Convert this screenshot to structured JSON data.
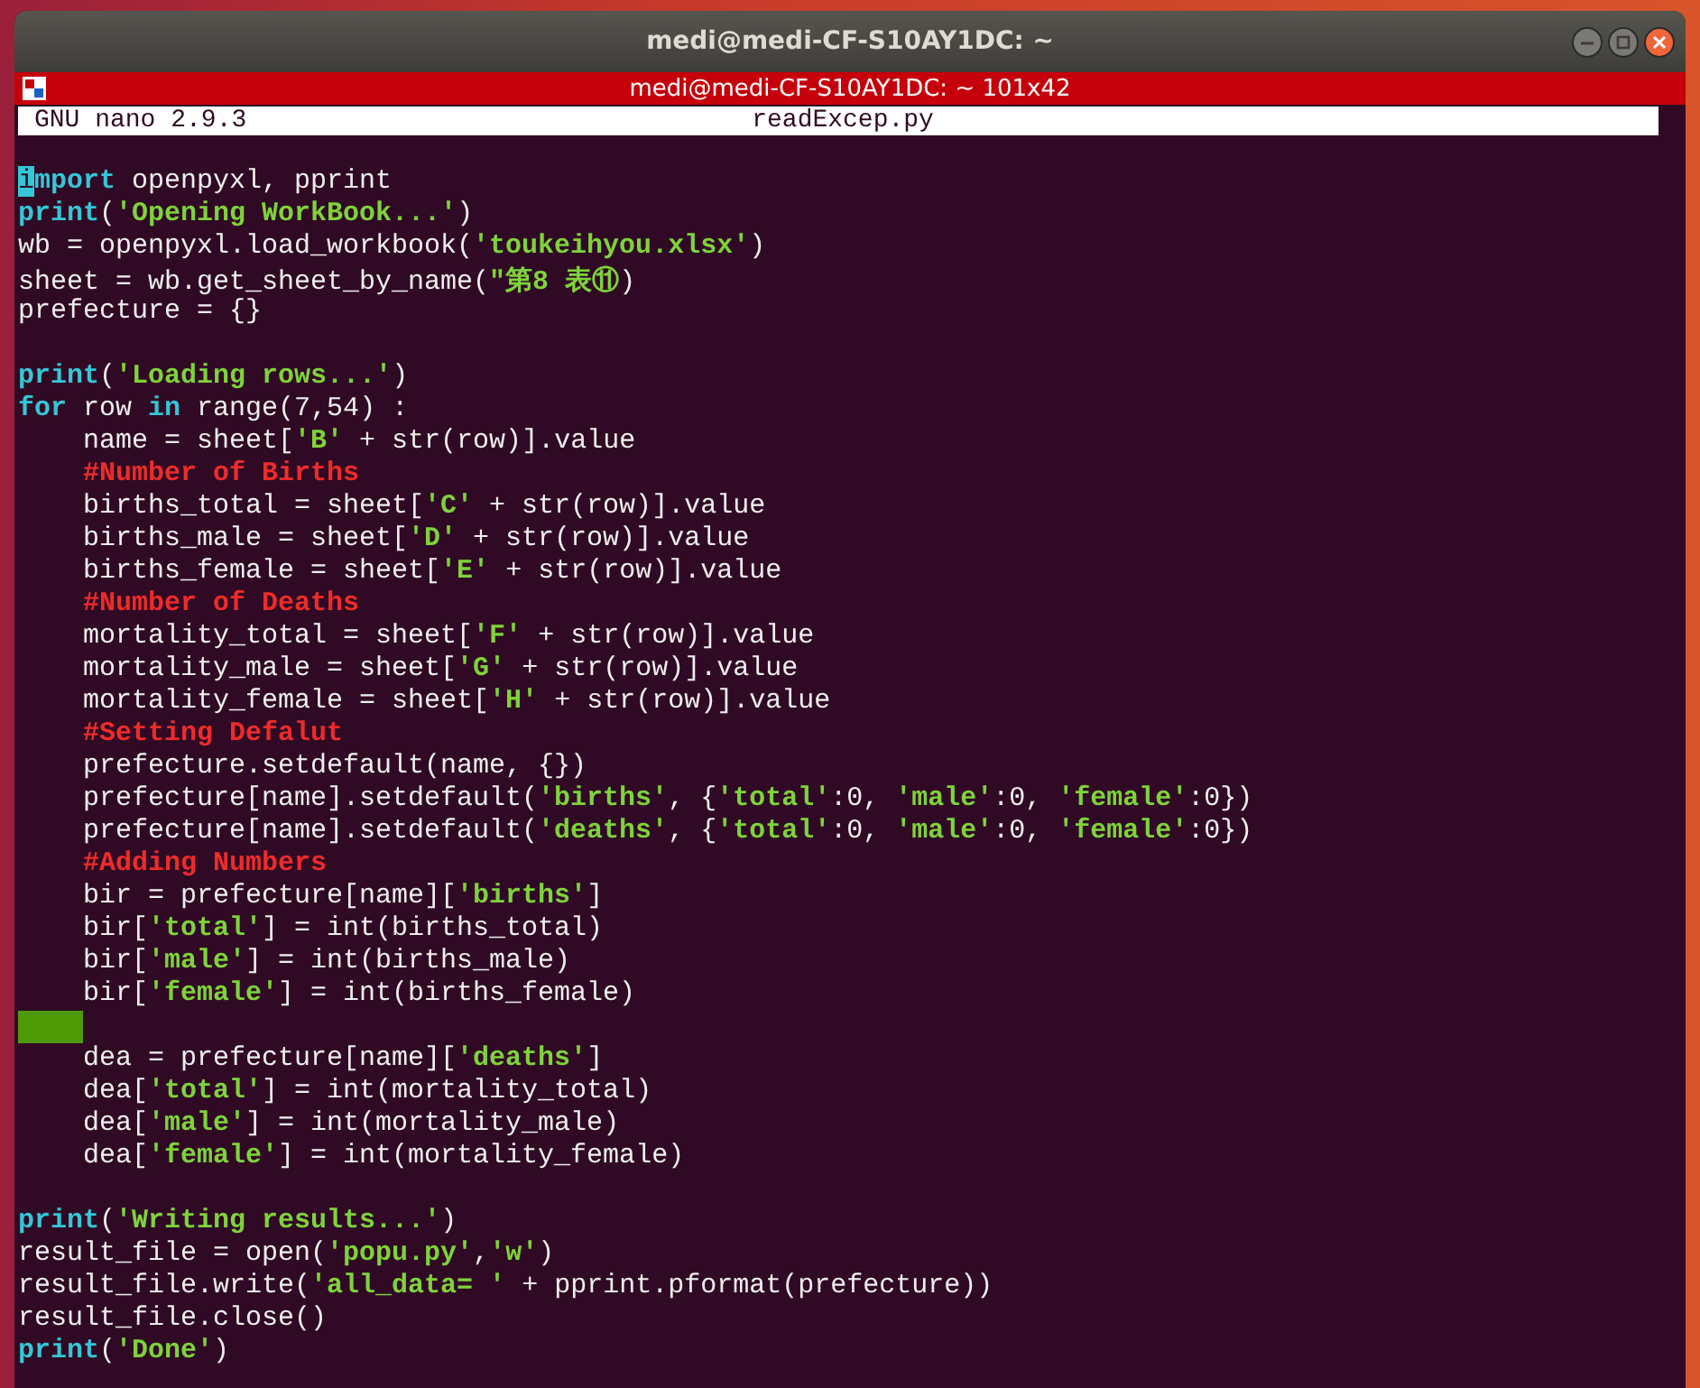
{
  "window": {
    "title": "medi@medi-CF-S10AY1DC: ~"
  },
  "terminal_bar": {
    "title": "medi@medi-CF-S10AY1DC: ~ 101x42"
  },
  "nano_header": {
    "version": "GNU nano 2.9.3",
    "filename": "readExcep.py"
  },
  "lines": [
    {
      "kind": "code",
      "segments": [
        {
          "kind": "cursor",
          "text": "i"
        },
        {
          "kind": "keyword",
          "text": "mport"
        },
        {
          "kind": "plain",
          "text": " openpyxl, pprint"
        }
      ]
    },
    {
      "kind": "code",
      "segments": [
        {
          "kind": "keyword",
          "text": "print"
        },
        {
          "kind": "plain",
          "text": "("
        },
        {
          "kind": "string",
          "text": "'Opening WorkBook...'"
        },
        {
          "kind": "plain",
          "text": ")"
        }
      ]
    },
    {
      "kind": "code",
      "segments": [
        {
          "kind": "plain",
          "text": "wb = openpyxl.load_workbook("
        },
        {
          "kind": "string",
          "text": "'toukeihyou.xlsx'"
        },
        {
          "kind": "plain",
          "text": ")"
        }
      ]
    },
    {
      "kind": "code",
      "segments": [
        {
          "kind": "plain",
          "text": "sheet = wb.get_sheet_by_name("
        },
        {
          "kind": "string",
          "text": "\"第8 表⑪"
        },
        {
          "kind": "plain",
          "text": ")"
        }
      ]
    },
    {
      "kind": "code",
      "segments": [
        {
          "kind": "plain",
          "text": "prefecture = {}"
        }
      ]
    },
    {
      "kind": "blank"
    },
    {
      "kind": "code",
      "segments": [
        {
          "kind": "keyword",
          "text": "print"
        },
        {
          "kind": "plain",
          "text": "("
        },
        {
          "kind": "string",
          "text": "'Loading rows...'"
        },
        {
          "kind": "plain",
          "text": ")"
        }
      ]
    },
    {
      "kind": "code",
      "segments": [
        {
          "kind": "keyword",
          "text": "for"
        },
        {
          "kind": "plain",
          "text": " row "
        },
        {
          "kind": "keyword",
          "text": "in"
        },
        {
          "kind": "plain",
          "text": " range(7,54) :"
        }
      ],
      "children": [
        {
          "kind": "code",
          "segments": [
            {
              "kind": "plain",
              "text": "name = sheet["
            },
            {
              "kind": "string",
              "text": "'B'"
            },
            {
              "kind": "plain",
              "text": " + str(row)].value"
            }
          ]
        },
        {
          "kind": "code",
          "segments": [
            {
              "kind": "comment",
              "text": "#Number of Births"
            }
          ]
        },
        {
          "kind": "code",
          "segments": [
            {
              "kind": "plain",
              "text": "births_total = sheet["
            },
            {
              "kind": "string",
              "text": "'C'"
            },
            {
              "kind": "plain",
              "text": " + str(row)].value"
            }
          ]
        },
        {
          "kind": "code",
          "segments": [
            {
              "kind": "plain",
              "text": "births_male = sheet["
            },
            {
              "kind": "string",
              "text": "'D'"
            },
            {
              "kind": "plain",
              "text": " + str(row)].value"
            }
          ]
        },
        {
          "kind": "code",
          "segments": [
            {
              "kind": "plain",
              "text": "births_female = sheet["
            },
            {
              "kind": "string",
              "text": "'E'"
            },
            {
              "kind": "plain",
              "text": " + str(row)].value"
            }
          ]
        },
        {
          "kind": "code",
          "segments": [
            {
              "kind": "comment",
              "text": "#Number of Deaths"
            }
          ]
        },
        {
          "kind": "code",
          "segments": [
            {
              "kind": "plain",
              "text": "mortality_total = sheet["
            },
            {
              "kind": "string",
              "text": "'F'"
            },
            {
              "kind": "plain",
              "text": " + str(row)].value"
            }
          ]
        },
        {
          "kind": "code",
          "segments": [
            {
              "kind": "plain",
              "text": "mortality_male = sheet["
            },
            {
              "kind": "string",
              "text": "'G'"
            },
            {
              "kind": "plain",
              "text": " + str(row)].value"
            }
          ]
        },
        {
          "kind": "code",
          "segments": [
            {
              "kind": "plain",
              "text": "mortality_female = sheet["
            },
            {
              "kind": "string",
              "text": "'H'"
            },
            {
              "kind": "plain",
              "text": " + str(row)].value"
            }
          ]
        },
        {
          "kind": "code",
          "segments": [
            {
              "kind": "comment",
              "text": "#Setting Defalut"
            }
          ]
        },
        {
          "kind": "code",
          "segments": [
            {
              "kind": "plain",
              "text": "prefecture.setdefault(name, {})"
            }
          ]
        },
        {
          "kind": "code",
          "segments": [
            {
              "kind": "plain",
              "text": "prefecture[name].setdefault("
            },
            {
              "kind": "string",
              "text": "'births'"
            },
            {
              "kind": "plain",
              "text": ", {"
            },
            {
              "kind": "string",
              "text": "'total'"
            },
            {
              "kind": "plain",
              "text": ":0, "
            },
            {
              "kind": "string",
              "text": "'male'"
            },
            {
              "kind": "plain",
              "text": ":0, "
            },
            {
              "kind": "string",
              "text": "'female'"
            },
            {
              "kind": "plain",
              "text": ":0})"
            }
          ]
        },
        {
          "kind": "code",
          "segments": [
            {
              "kind": "plain",
              "text": "prefecture[name].setdefault("
            },
            {
              "kind": "string",
              "text": "'deaths'"
            },
            {
              "kind": "plain",
              "text": ", {"
            },
            {
              "kind": "string",
              "text": "'total'"
            },
            {
              "kind": "plain",
              "text": ":0, "
            },
            {
              "kind": "string",
              "text": "'male'"
            },
            {
              "kind": "plain",
              "text": ":0, "
            },
            {
              "kind": "string",
              "text": "'female'"
            },
            {
              "kind": "plain",
              "text": ":0})"
            }
          ]
        },
        {
          "kind": "code",
          "segments": [
            {
              "kind": "comment",
              "text": "#Adding Numbers"
            }
          ]
        },
        {
          "kind": "code",
          "segments": [
            {
              "kind": "plain",
              "text": "bir = prefecture[name]["
            },
            {
              "kind": "string",
              "text": "'births'"
            },
            {
              "kind": "plain",
              "text": "]"
            }
          ]
        },
        {
          "kind": "code",
          "segments": [
            {
              "kind": "plain",
              "text": "bir["
            },
            {
              "kind": "string",
              "text": "'total'"
            },
            {
              "kind": "plain",
              "text": "] = int(births_total)"
            }
          ]
        },
        {
          "kind": "code",
          "segments": [
            {
              "kind": "plain",
              "text": "bir["
            },
            {
              "kind": "string",
              "text": "'male'"
            },
            {
              "kind": "plain",
              "text": "] = int(births_male)"
            }
          ]
        },
        {
          "kind": "code",
          "segments": [
            {
              "kind": "plain",
              "text": "bir["
            },
            {
              "kind": "string",
              "text": "'female'"
            },
            {
              "kind": "plain",
              "text": "] = int(births_female)"
            }
          ]
        },
        {
          "kind": "whitespace"
        },
        {
          "kind": "code",
          "segments": [
            {
              "kind": "plain",
              "text": "dea = prefecture[name]["
            },
            {
              "kind": "string",
              "text": "'deaths'"
            },
            {
              "kind": "plain",
              "text": "]"
            }
          ]
        },
        {
          "kind": "code",
          "segments": [
            {
              "kind": "plain",
              "text": "dea["
            },
            {
              "kind": "string",
              "text": "'total'"
            },
            {
              "kind": "plain",
              "text": "] = int(mortality_total)"
            }
          ]
        },
        {
          "kind": "code",
          "segments": [
            {
              "kind": "plain",
              "text": "dea["
            },
            {
              "kind": "string",
              "text": "'male'"
            },
            {
              "kind": "plain",
              "text": "] = int(mortality_male)"
            }
          ]
        },
        {
          "kind": "code",
          "segments": [
            {
              "kind": "plain",
              "text": "dea["
            },
            {
              "kind": "string",
              "text": "'female'"
            },
            {
              "kind": "plain",
              "text": "] = int(mortality_female)"
            }
          ]
        }
      ]
    },
    {
      "kind": "blank"
    },
    {
      "kind": "code",
      "segments": [
        {
          "kind": "keyword",
          "text": "print"
        },
        {
          "kind": "plain",
          "text": "("
        },
        {
          "kind": "string",
          "text": "'Writing results...'"
        },
        {
          "kind": "plain",
          "text": ")"
        }
      ]
    },
    {
      "kind": "code",
      "segments": [
        {
          "kind": "plain",
          "text": "result_file = open("
        },
        {
          "kind": "string",
          "text": "'popu.py'"
        },
        {
          "kind": "plain",
          "text": ","
        },
        {
          "kind": "string",
          "text": "'w'"
        },
        {
          "kind": "plain",
          "text": ")"
        }
      ]
    },
    {
      "kind": "code",
      "segments": [
        {
          "kind": "plain",
          "text": "result_file.write("
        },
        {
          "kind": "string",
          "text": "'all_data= '"
        },
        {
          "kind": "plain",
          "text": " + pprint.pformat(prefecture))"
        }
      ]
    },
    {
      "kind": "code",
      "segments": [
        {
          "kind": "plain",
          "text": "result_file.close()"
        }
      ]
    },
    {
      "kind": "code",
      "segments": [
        {
          "kind": "keyword",
          "text": "print"
        },
        {
          "kind": "plain",
          "text": "("
        },
        {
          "kind": "string",
          "text": "'Done'"
        },
        {
          "kind": "plain",
          "text": ")"
        }
      ]
    }
  ]
}
